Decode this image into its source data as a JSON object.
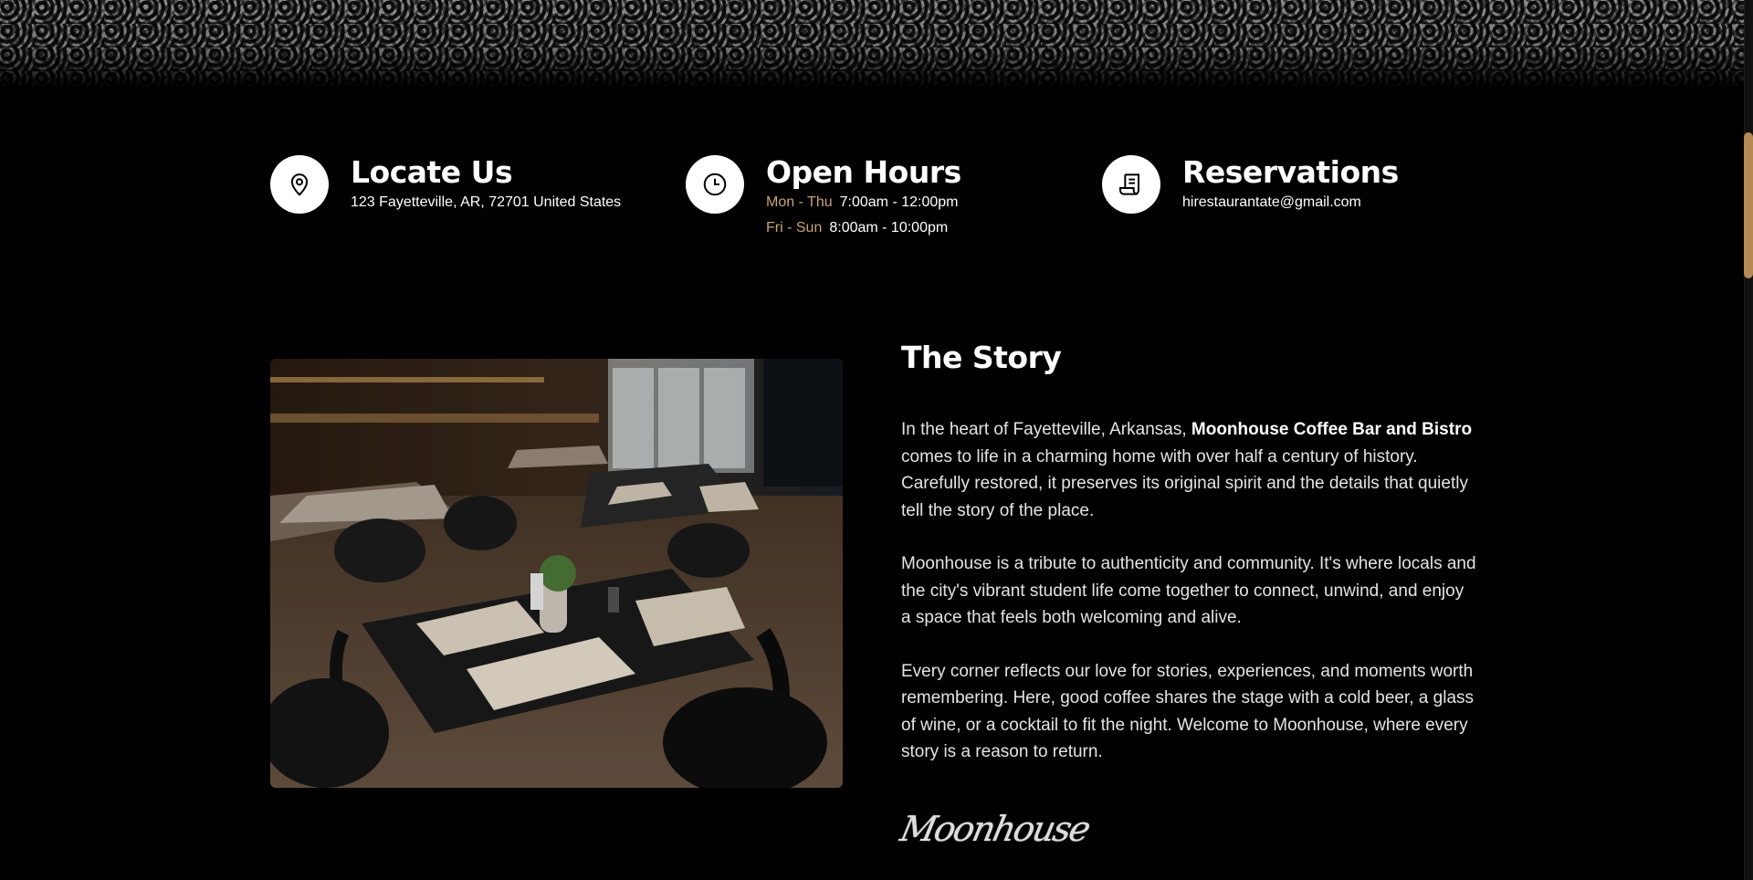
{
  "info": {
    "locate": {
      "icon": "location-pin-icon",
      "title": "Locate Us",
      "address": "123 Fayetteville, AR, 72701 United States"
    },
    "hours": {
      "icon": "clock-icon",
      "title": "Open Hours",
      "rows": [
        {
          "days": "Mon - Thu",
          "time": "7:00am - 12:00pm"
        },
        {
          "days": "Fri - Sun",
          "time": "8:00am - 10:00pm"
        }
      ]
    },
    "reservations": {
      "icon": "reservation-scroll-icon",
      "title": "Reservations",
      "email": "hirestaurantate@gmail.com"
    }
  },
  "story": {
    "title": "The Story",
    "p1_pre": "In the heart of Fayetteville, Arkansas, ",
    "p1_bold": "Moonhouse Coffee Bar and Bistro",
    "p1_post": " comes to life in a charming home with over half a century of history. Carefully restored, it preserves its original spirit and the details that quietly tell the story of the place.",
    "p2": "Moonhouse is a tribute to authenticity and community. It's where locals and the city's vibrant student life come together to connect, unwind, and enjoy a space that feels both welcoming and alive.",
    "p3": "Every corner reflects our love for stories, experiences, and moments worth remembering. Here, good coffee shares the stage with a cold beer, a glass of wine, or a cocktail to fit the night. Welcome to Moonhouse, where every story is a reason to return.",
    "signature": "Moonhouse"
  },
  "colors": {
    "background": "#000000",
    "accent": "#c9a374",
    "scrollbar": "#b58a55"
  }
}
